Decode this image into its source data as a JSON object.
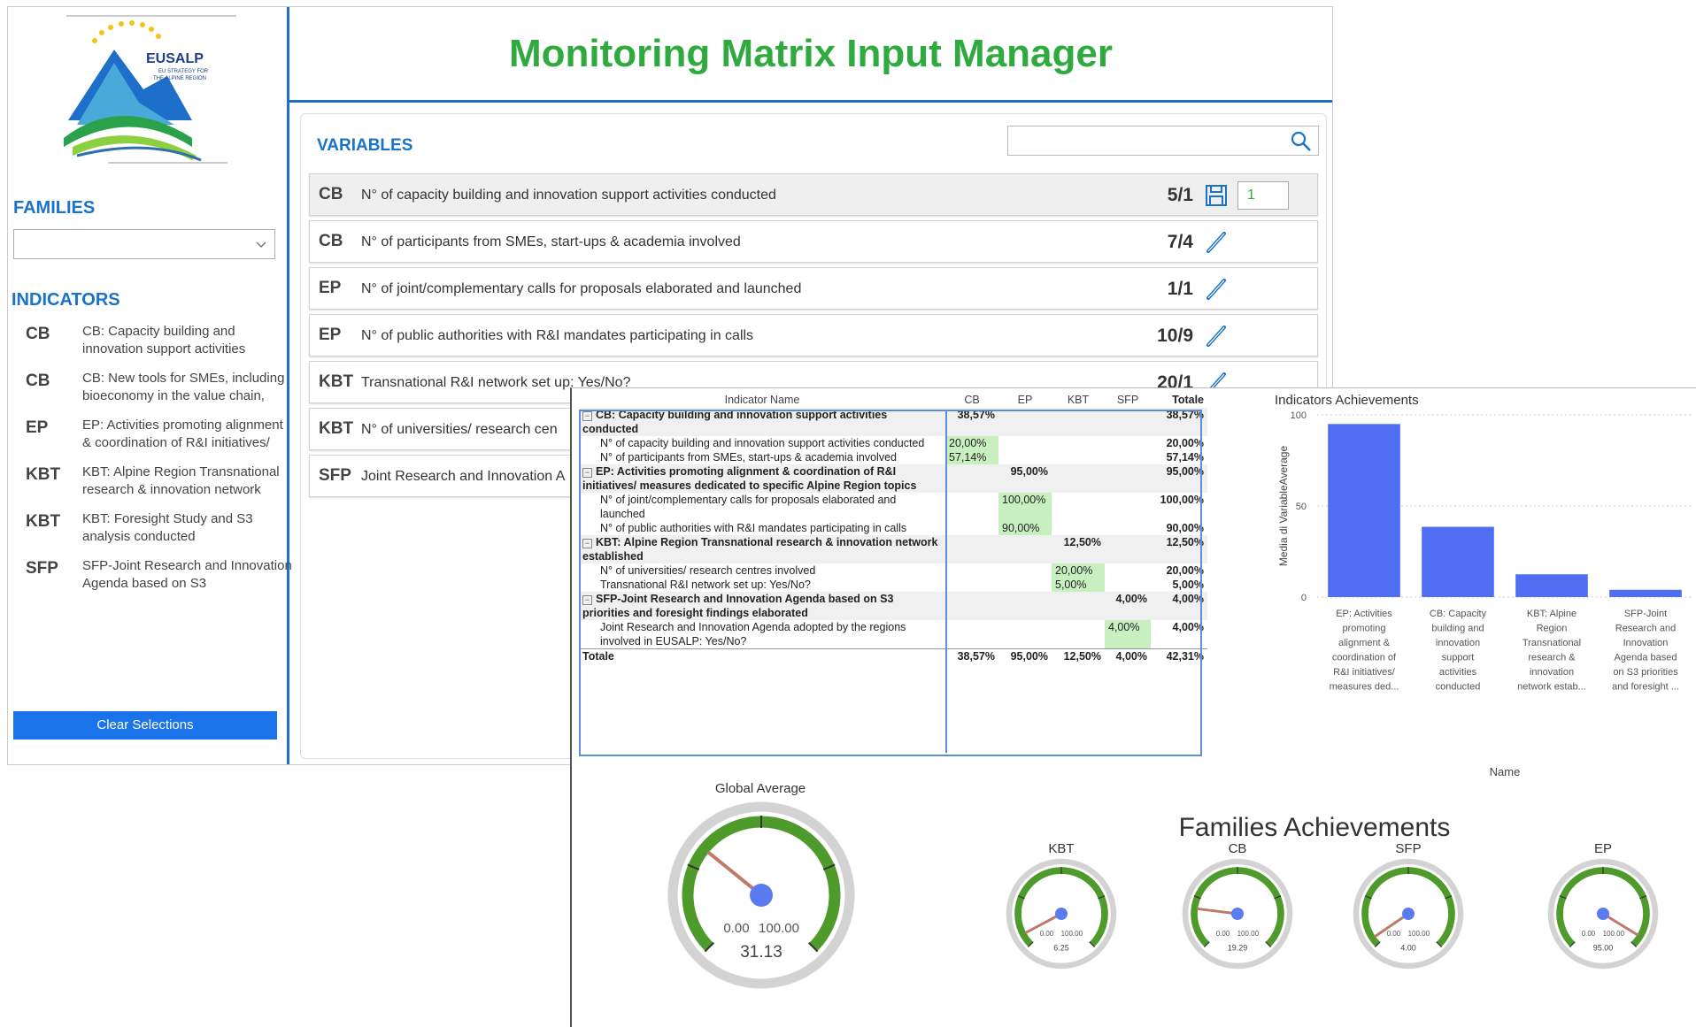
{
  "app": {
    "title": "Monitoring Matrix Input Manager",
    "logo_text": "EUSALP",
    "logo_subtext": [
      "EU STRATEGY FOR",
      "THE ALPINE REGION"
    ]
  },
  "sidebar": {
    "families_title": "FAMILIES",
    "families_selected": "",
    "indicators_title": "INDICATORS",
    "indicators": [
      {
        "code": "CB",
        "label": "CB: Capacity building and innovation support activities"
      },
      {
        "code": "CB",
        "label": "CB: New tools for SMEs, including bioeconomy in the value chain,"
      },
      {
        "code": "EP",
        "label": "EP: Activities promoting alignment & coordination of R&I initiatives/"
      },
      {
        "code": "KBT",
        "label": "KBT: Alpine Region Transnational research & innovation network"
      },
      {
        "code": "KBT",
        "label": "KBT: Foresight Study and S3 analysis conducted"
      },
      {
        "code": "SFP",
        "label": "SFP-Joint Research and Innovation Agenda based on S3"
      }
    ],
    "clear_label": "Clear Selections"
  },
  "variables": {
    "title": "VARIABLES",
    "search_placeholder": "",
    "rows": [
      {
        "code": "CB",
        "desc": "N° of capacity building and innovation support activities conducted",
        "ratio": "5/1",
        "input_value": "1",
        "active": true
      },
      {
        "code": "CB",
        "desc": "N° of participants from SMEs, start-ups & academia involved",
        "ratio": "7/4"
      },
      {
        "code": "EP",
        "desc": "N° of joint/complementary calls for proposals elaborated and launched",
        "ratio": "1/1"
      },
      {
        "code": "EP",
        "desc": "N° of public authorities with R&I mandates participating in calls",
        "ratio": "10/9"
      },
      {
        "code": "KBT",
        "desc": "Transnational R&I network set up: Yes/No?",
        "ratio": "20/1"
      },
      {
        "code": "KBT",
        "desc": "N° of universities/ research cen",
        "ratio": ""
      },
      {
        "code": "SFP",
        "desc": "Joint Research and Innovation A",
        "ratio": ""
      }
    ]
  },
  "matrix": {
    "headers": [
      "Indicator Name",
      "CB",
      "EP",
      "KBT",
      "SFP",
      "Totale"
    ],
    "rows": [
      {
        "type": "grp",
        "name": "CB: Capacity building and innovation support activities conducted",
        "cb": "38,57%",
        "ep": "",
        "kbt": "",
        "sfp": "",
        "tot": "38,57%"
      },
      {
        "type": "child",
        "name": "N° of capacity building and innovation support activities conducted",
        "cb": "20,00%",
        "ep": "",
        "kbt": "",
        "sfp": "",
        "tot": "20,00%"
      },
      {
        "type": "child",
        "name": "N° of participants from SMEs, start-ups & academia involved",
        "cb": "57,14%",
        "ep": "",
        "kbt": "",
        "sfp": "",
        "tot": "57,14%"
      },
      {
        "type": "grp",
        "name": "EP: Activities promoting alignment & coordination of R&I initiatives/ measures dedicated to specific Alpine Region topics",
        "cb": "",
        "ep": "95,00%",
        "kbt": "",
        "sfp": "",
        "tot": "95,00%"
      },
      {
        "type": "child",
        "name": "N° of joint/complementary calls for proposals elaborated and launched",
        "cb": "",
        "ep": "100,00%",
        "kbt": "",
        "sfp": "",
        "tot": "100,00%"
      },
      {
        "type": "child",
        "name": "N° of public authorities with R&I mandates participating in calls",
        "cb": "",
        "ep": "90,00%",
        "kbt": "",
        "sfp": "",
        "tot": "90,00%"
      },
      {
        "type": "grp",
        "name": "KBT: Alpine Region Transnational research & innovation network established",
        "cb": "",
        "ep": "",
        "kbt": "12,50%",
        "sfp": "",
        "tot": "12,50%"
      },
      {
        "type": "child",
        "name": "N° of universities/ research centres involved",
        "cb": "",
        "ep": "",
        "kbt": "20,00%",
        "sfp": "",
        "tot": "20,00%"
      },
      {
        "type": "child",
        "name": "Transnational R&I network set up: Yes/No?",
        "cb": "",
        "ep": "",
        "kbt": "5,00%",
        "sfp": "",
        "tot": "5,00%"
      },
      {
        "type": "grp",
        "name": "SFP-Joint Research and Innovation Agenda based on S3 priorities and foresight findings elaborated",
        "cb": "",
        "ep": "",
        "kbt": "",
        "sfp": "4,00%",
        "tot": "4,00%"
      },
      {
        "type": "child",
        "name": "Joint Research and Innovation Agenda adopted by the regions involved in EUSALP: Yes/No?",
        "cb": "",
        "ep": "",
        "kbt": "",
        "sfp": "4,00%",
        "tot": "4,00%"
      },
      {
        "type": "total",
        "name": "Totale",
        "cb": "38,57%",
        "ep": "95,00%",
        "kbt": "12,50%",
        "sfp": "4,00%",
        "tot": "42,31%"
      }
    ]
  },
  "chart_data": [
    {
      "type": "bar",
      "title": "Indicators Achievements",
      "xlabel": "Name",
      "ylabel": "Media di VariableAverage",
      "ylim": [
        0,
        100
      ],
      "yticks": [
        0,
        50,
        100
      ],
      "categories": [
        "EP: Activities promoting alignment & coordination of R&I initiatives/ measures ded...",
        "CB: Capacity building and innovation support activities conducted",
        "KBT: Alpine Region Transnational research & innovation network estab...",
        "SFP-Joint Research and Innovation Agenda based on S3 priorities and foresight ..."
      ],
      "category_lines": [
        [
          "EP: Activities",
          "promoting",
          "alignment &",
          "coordination of",
          "R&I initiatives/",
          "measures ded..."
        ],
        [
          "CB: Capacity",
          "building and",
          "innovation",
          "support",
          "activities",
          "conducted"
        ],
        [
          "KBT: Alpine",
          "Region",
          "Transnational",
          "research &",
          "innovation",
          "network estab..."
        ],
        [
          "SFP-Joint",
          "Research and",
          "Innovation",
          "Agenda based",
          "on S3 priorities",
          "and foresight ..."
        ]
      ],
      "values": [
        95,
        38.57,
        12.5,
        4
      ],
      "color": "#4f6ef2"
    }
  ],
  "gauges": {
    "global": {
      "title": "Global Average",
      "min": "0.00",
      "max": "100.00",
      "value": 31.13,
      "value_label": "31.13"
    },
    "families_title": "Families Achievements",
    "families": [
      {
        "title": "KBT",
        "min": "0.00",
        "max": "100.00",
        "value": 6.25,
        "value_label": "6.25"
      },
      {
        "title": "CB",
        "min": "0.00",
        "max": "100.00",
        "value": 19.29,
        "value_label": "19.29"
      },
      {
        "title": "SFP",
        "min": "0.00",
        "max": "100.00",
        "value": 4.0,
        "value_label": "4.00"
      },
      {
        "title": "EP",
        "min": "0.00",
        "max": "100.00",
        "value": 95.0,
        "value_label": "95.00"
      }
    ],
    "colors": {
      "arc": "#4e9a2b",
      "needle": "#c07a6a",
      "hub": "#5b7cf0",
      "ring": "#d3d3d3"
    }
  },
  "colors": {
    "accent": "#1a73c8",
    "title_green": "#2eaa3f",
    "highlight": "#c8efc0",
    "button": "#1a73e8"
  }
}
